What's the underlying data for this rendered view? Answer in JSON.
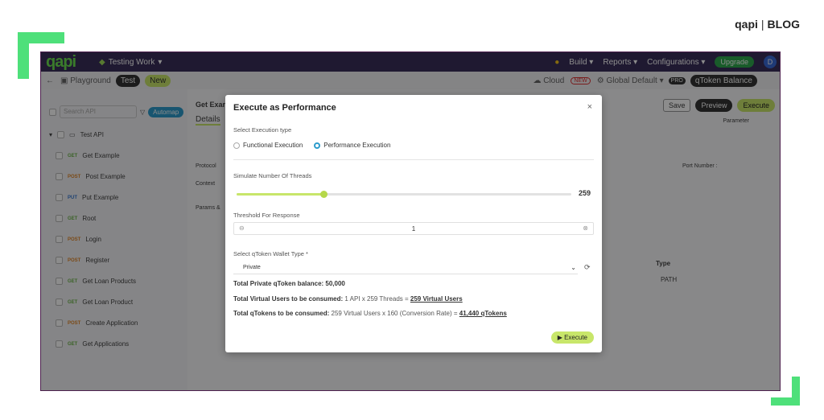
{
  "brand": {
    "logo": "qapi",
    "sep": "|",
    "label": "BLOG"
  },
  "topbar": {
    "logo": "qapi",
    "workspace": "Testing Work",
    "menus": [
      "Build",
      "Reports",
      "Configurations"
    ],
    "upgrade": "Upgrade",
    "avatar": "D"
  },
  "subbar": {
    "playground": "Playground",
    "test": "Test",
    "new": "New",
    "cloud": "Cloud",
    "new_badge": "NEW",
    "env": "Global Default",
    "pro_badge": "PRO",
    "token_balance": "qToken Balance"
  },
  "sidebar": {
    "search_placeholder": "Search API",
    "automap": "Automap",
    "folder": "Test API",
    "items": [
      {
        "method": "GET",
        "name": "Get Example"
      },
      {
        "method": "POST",
        "name": "Post Example"
      },
      {
        "method": "PUT",
        "name": "Put Example"
      },
      {
        "method": "GET",
        "name": "Root"
      },
      {
        "method": "POST",
        "name": "Login"
      },
      {
        "method": "POST",
        "name": "Register"
      },
      {
        "method": "GET",
        "name": "Get Loan Products"
      },
      {
        "method": "GET",
        "name": "Get Loan Product"
      },
      {
        "method": "POST",
        "name": "Create Application"
      },
      {
        "method": "GET",
        "name": "Get Applications"
      }
    ]
  },
  "main": {
    "title": "Get Exan",
    "tab": "Details",
    "save": "Save",
    "preview": "Preview",
    "execute": "Execute",
    "parameter": "Parameter",
    "protocol": "Protocol",
    "context": "Context",
    "port_number": "Port Number :",
    "params": "Params &",
    "type": "Type",
    "path": "PATH"
  },
  "modal": {
    "title": "Execute as Performance",
    "close": "×",
    "execution_type_label": "Select Execution type",
    "functional": "Functional Execution",
    "performance": "Performance Execution",
    "threads_label": "Simulate Number Of Threads",
    "threads_value": "259",
    "threads_fraction": 0.26,
    "threshold_label": "Threshold For Response",
    "threshold_value": "1",
    "wallet_label": "Select qToken Wallet Type *",
    "wallet_value": "Private",
    "balance_text": "Total Private qToken balance: 50,000",
    "virtual_users_label": "Total Virtual Users to be consumed:",
    "virtual_users_calc": "1 API x 259 Threads =",
    "virtual_users_result": "259 Virtual Users",
    "qtokens_label": "Total qTokens to be consumed:",
    "qtokens_calc": "259 Virtual Users x 160 (Conversion Rate) =",
    "qtokens_result": "41,440 qTokens",
    "execute": "Execute"
  },
  "colors": {
    "accent": "#c8e66a",
    "brand_green": "#4ee07a",
    "topbar": "#3a2f5a"
  }
}
